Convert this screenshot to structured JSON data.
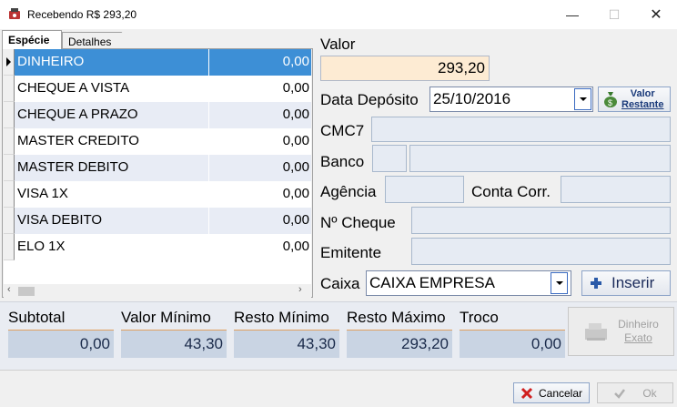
{
  "window": {
    "title": "Recebendo R$ 293,20"
  },
  "tabs": [
    {
      "label": "Espécie"
    },
    {
      "label": "Detalhes"
    }
  ],
  "payment_rows": [
    {
      "name": "DINHEIRO",
      "value": "0,00"
    },
    {
      "name": "CHEQUE A VISTA",
      "value": "0,00"
    },
    {
      "name": "CHEQUE A PRAZO",
      "value": "0,00"
    },
    {
      "name": "MASTER CREDITO",
      "value": "0,00"
    },
    {
      "name": "MASTER DEBITO",
      "value": "0,00"
    },
    {
      "name": "VISA 1X",
      "value": "0,00"
    },
    {
      "name": "VISA DEBITO",
      "value": "0,00"
    },
    {
      "name": "ELO 1X",
      "value": "0,00"
    }
  ],
  "form": {
    "valor_label": "Valor",
    "valor_value": "293,20",
    "data_deposito_label": "Data Depósito",
    "data_deposito_value": "25/10/2016",
    "valor_restante_line1": "Valor",
    "valor_restante_line2": "Restante",
    "cmc7_label": "CMC7",
    "banco_label": "Banco",
    "agencia_label": "Agência",
    "conta_label": "Conta Corr.",
    "cheque_label": "Nº Cheque",
    "emitente_label": "Emitente",
    "caixa_label": "Caixa",
    "caixa_value": "CAIXA EMPRESA",
    "inserir_label": "Inserir"
  },
  "totals": {
    "subtotal_label": "Subtotal",
    "subtotal_value": "0,00",
    "minimo_label": "Valor Mínimo",
    "minimo_value": "43,30",
    "resto_min_label": "Resto Mínimo",
    "resto_min_value": "43,30",
    "resto_max_label": "Resto Máximo",
    "resto_max_value": "293,20",
    "troco_label": "Troco",
    "troco_value": "0,00",
    "dinheiro_exato_line1": "Dinheiro",
    "dinheiro_exato_line2": "Exato"
  },
  "footer": {
    "cancel_label": "Cancelar",
    "ok_label": "Ok"
  },
  "colors": {
    "selection": "#3d8fd6",
    "valor_bg": "#fdebd3",
    "field_bg": "#e6ebf3"
  }
}
